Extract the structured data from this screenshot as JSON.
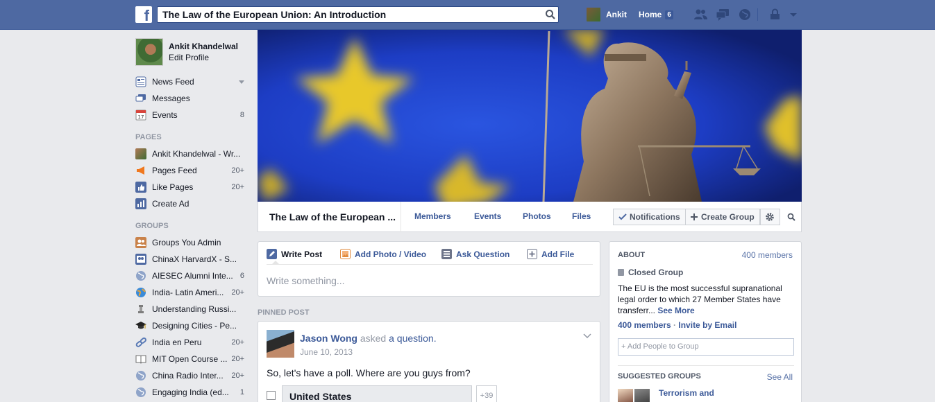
{
  "topbar": {
    "logo": "f",
    "search_value": "The Law of the European Union: An Introduction",
    "user_name": "Ankit",
    "home_label": "Home",
    "home_count": "6"
  },
  "sidebar": {
    "profile_name": "Ankit Khandelwal",
    "edit_profile": "Edit Profile",
    "favorites": [
      {
        "label": "News Feed",
        "count": ""
      },
      {
        "label": "Messages",
        "count": ""
      },
      {
        "label": "Events",
        "count": "8"
      }
    ],
    "pages_header": "PAGES",
    "pages": [
      {
        "label": "Ankit Khandelwal - Wr...",
        "count": ""
      },
      {
        "label": "Pages Feed",
        "count": "20+"
      },
      {
        "label": "Like Pages",
        "count": "20+"
      },
      {
        "label": "Create Ad",
        "count": ""
      }
    ],
    "groups_header": "GROUPS",
    "groups": [
      {
        "label": "Groups You Admin",
        "count": ""
      },
      {
        "label": "ChinaX HarvardX - S...",
        "count": ""
      },
      {
        "label": "AIESEC Alumni Inte...",
        "count": "6"
      },
      {
        "label": "India- Latin Ameri...",
        "count": "20+"
      },
      {
        "label": "Understanding Russi...",
        "count": ""
      },
      {
        "label": "Designing Cities - Pe...",
        "count": ""
      },
      {
        "label": "India en Peru",
        "count": "20+"
      },
      {
        "label": "MIT Open Course ...",
        "count": "20+"
      },
      {
        "label": "China Radio Inter...",
        "count": "20+"
      },
      {
        "label": "Engaging India (ed...",
        "count": "1"
      }
    ]
  },
  "group": {
    "name": "The Law of the European ...",
    "tabs": [
      "Members",
      "Events",
      "Photos",
      "Files"
    ],
    "notifications": "Notifications",
    "create_group": "Create Group"
  },
  "composer": {
    "tabs": [
      "Write Post",
      "Add Photo / Video",
      "Ask Question",
      "Add File"
    ],
    "placeholder": "Write something..."
  },
  "pinned": {
    "header": "PINNED POST",
    "author": "Jason Wong",
    "action": " asked ",
    "object": "a question.",
    "date": "June 10, 2013",
    "body": "So, let's have a poll. Where are you guys from?",
    "option": "United States",
    "option_more": "+39"
  },
  "about": {
    "header": "ABOUT",
    "members_count": "400 members",
    "privacy": "Closed Group",
    "description": "The EU is the most successful supranational legal order to which 27 Member States have transferr...",
    "see_more": "See More",
    "members_link": "400 members",
    "sep": " · ",
    "invite": "Invite by Email",
    "add_placeholder": "+ Add People to Group",
    "suggested_header": "SUGGESTED GROUPS",
    "see_all": "See All",
    "suggested_name": "Terrorism and"
  },
  "colors": {
    "brand": "#4e69a2",
    "link": "#3b5998",
    "background": "#e9eaed"
  }
}
